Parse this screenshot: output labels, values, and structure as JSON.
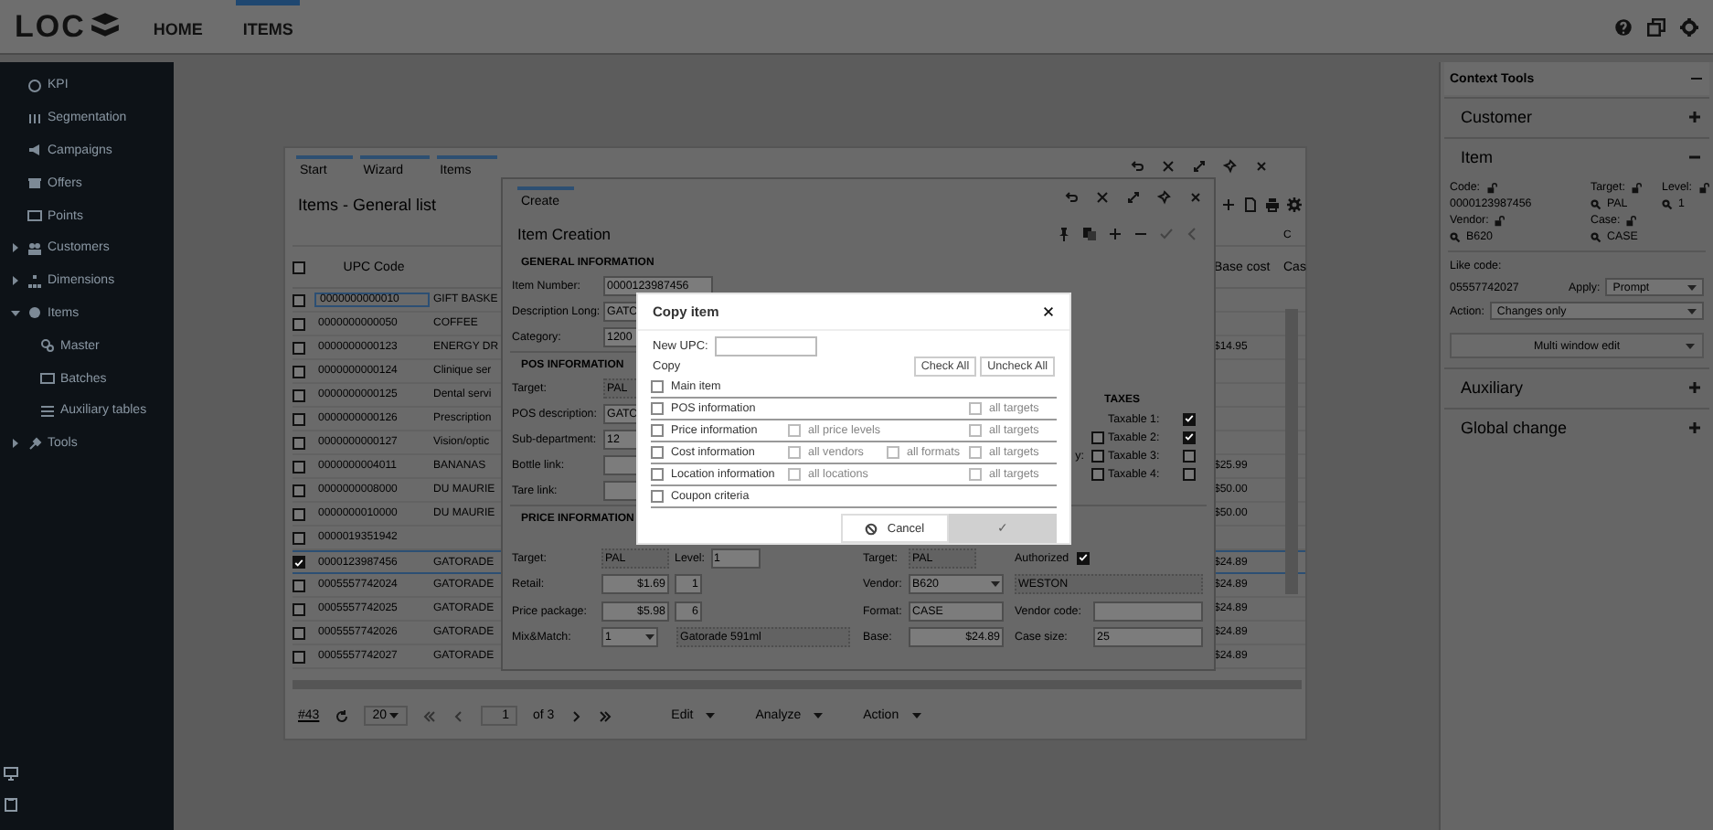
{
  "top_bar": {
    "logo": "LOC",
    "nav": [
      {
        "label": "HOME",
        "selected": false
      },
      {
        "label": "ITEMS",
        "selected": true
      }
    ]
  },
  "sidebar": {
    "items": [
      {
        "label": "KPI"
      },
      {
        "label": "Segmentation"
      },
      {
        "label": "Campaigns"
      },
      {
        "label": "Offers"
      },
      {
        "label": "Points"
      },
      {
        "label": "Customers",
        "expanded": false
      },
      {
        "label": "Dimensions",
        "expanded": false
      },
      {
        "label": "Items",
        "expanded": true,
        "children": [
          {
            "label": "Master"
          },
          {
            "label": "Batches"
          },
          {
            "label": "Auxiliary tables"
          }
        ]
      },
      {
        "label": "Tools",
        "expanded": false
      }
    ]
  },
  "list_window": {
    "breadcrumbs": [
      "Start",
      "Wizard",
      "Items"
    ],
    "title": "Items - General list",
    "group_header": "C",
    "select_all_checked": false,
    "columns": [
      "UPC Code",
      "Base cost",
      "Cas"
    ],
    "rows": [
      {
        "checked": false,
        "upc": "0000000000010",
        "description": "GIFT BASKE"
      },
      {
        "checked": false,
        "upc": "0000000000050",
        "description": "COFFEE"
      },
      {
        "checked": false,
        "upc": "0000000000123",
        "description": "ENERGY DR",
        "base_cost": "$14.95"
      },
      {
        "checked": false,
        "upc": "0000000000124",
        "description": "Clinique ser"
      },
      {
        "checked": false,
        "upc": "0000000000125",
        "description": "Dental servi"
      },
      {
        "checked": false,
        "upc": "0000000000126",
        "description": "Prescription"
      },
      {
        "checked": false,
        "upc": "0000000000127",
        "description": "Vision/optic"
      },
      {
        "checked": false,
        "upc": "0000000004011",
        "description": "BANANAS",
        "base_cost": "$25.99"
      },
      {
        "checked": false,
        "upc": "0000000008000",
        "description": "DU MAURIE",
        "base_cost": "$50.00"
      },
      {
        "checked": false,
        "upc": "0000000010000",
        "description": "DU MAURIE",
        "base_cost": "$50.00"
      },
      {
        "checked": false,
        "upc": "0000019351942"
      },
      {
        "checked": true,
        "upc": "0000123987456",
        "description": "GATORADE",
        "base_cost": "$24.89"
      },
      {
        "checked": false,
        "upc": "0005557742024",
        "description": "GATORADE",
        "base_cost": "$24.89"
      },
      {
        "checked": false,
        "upc": "0005557742025",
        "description": "GATORADE",
        "base_cost": "$24.89"
      },
      {
        "checked": false,
        "upc": "0005557742026",
        "description": "GATORADE",
        "base_cost": "$24.89"
      },
      {
        "checked": false,
        "upc": "0005557742027",
        "description": "GATORADE",
        "base_cost": "$24.89"
      }
    ],
    "footer": {
      "count": "#43",
      "page_size": "20",
      "page": "1",
      "page_total": "of 3",
      "menus": [
        "Edit",
        "Analyze",
        "Action"
      ]
    }
  },
  "creation_window": {
    "tab": "Create",
    "title": "Item Creation",
    "general": {
      "heading": "GENERAL INFORMATION",
      "fields": [
        {
          "label": "Item Number:",
          "value": "0000123987456",
          "disabled": false
        },
        {
          "label": "Description Long:",
          "value": "GATO",
          "disabled": false
        },
        {
          "label": "Category:",
          "value": "1200",
          "disabled": false
        }
      ]
    },
    "pos": {
      "heading": "POS INFORMATION",
      "fields": [
        {
          "label": "Target:",
          "value": "PAL",
          "disabled": true
        },
        {
          "label": "POS description:",
          "value": "GATO",
          "disabled": false
        },
        {
          "label": "Sub-department:",
          "value": "12",
          "disabled": false
        },
        {
          "label": "Bottle link:",
          "disabled": false
        },
        {
          "label": "Tare link:",
          "disabled": false
        }
      ]
    },
    "flags": [
      {
        "checked": false
      },
      {
        "label": "y:",
        "checked": false
      },
      {
        "checked": false
      }
    ],
    "taxes": {
      "heading": "TAXES",
      "items": [
        {
          "label": "Taxable 1:",
          "checked": true
        },
        {
          "label": "Taxable 2:",
          "checked": true
        },
        {
          "label": "Taxable 3:",
          "checked": false
        },
        {
          "label": "Taxable 4:",
          "checked": false
        }
      ]
    },
    "price": {
      "heading": "PRICE INFORMATION",
      "target": {
        "label": "Target:",
        "value": "PAL"
      },
      "level": {
        "label": "Level:",
        "value": "1"
      },
      "rows": [
        {
          "label": "Retail:",
          "amount": "$1.69",
          "quantity": "1"
        },
        {
          "label": "Price package:",
          "amount": "$5.98",
          "quantity": "6"
        }
      ],
      "mix_match": {
        "label": "Mix&Match:",
        "value": "1",
        "description": "Gatorade 591ml"
      }
    },
    "cost": {
      "target": {
        "label": "Target:",
        "value": "PAL"
      },
      "authorized": {
        "label": "Authorized",
        "checked": true
      },
      "vendor": {
        "label": "Vendor:",
        "value": "B620",
        "name": "WESTON"
      },
      "format": {
        "label": "Format:",
        "value": "CASE"
      },
      "vendor_code": {
        "label": "Vendor code:"
      },
      "base": {
        "label": "Base:",
        "value": "$24.89"
      },
      "case_size": {
        "label": "Case size:",
        "value": "25"
      }
    }
  },
  "copy_dialog": {
    "title": "Copy item",
    "new_upc_label": "New UPC:",
    "copy_label": "Copy",
    "check_all": "Check All",
    "uncheck_all": "Uncheck All",
    "options": [
      {
        "label": "Main item",
        "checked": false
      },
      {
        "label": "POS information",
        "checked": false,
        "scopes": [
          {
            "kind": "target",
            "label": "all targets",
            "checked": false,
            "disabled": true
          }
        ]
      },
      {
        "label": "Price information",
        "checked": false,
        "scopes": [
          {
            "kind": "primary",
            "label": "all price levels",
            "checked": false,
            "disabled": true
          },
          {
            "kind": "target",
            "label": "all targets",
            "checked": false,
            "disabled": true
          }
        ]
      },
      {
        "label": "Cost information",
        "checked": false,
        "scopes": [
          {
            "kind": "primary",
            "label": "all vendors",
            "checked": false,
            "disabled": true
          },
          {
            "kind": "format",
            "label": "all formats",
            "checked": false,
            "disabled": true
          },
          {
            "kind": "target",
            "label": "all targets",
            "checked": false,
            "disabled": true
          }
        ]
      },
      {
        "label": "Location information",
        "checked": false,
        "scopes": [
          {
            "kind": "primary",
            "label": "all locations",
            "checked": false,
            "disabled": true
          },
          {
            "kind": "target",
            "label": "all targets",
            "checked": false,
            "disabled": true
          }
        ]
      },
      {
        "label": "Coupon criteria",
        "checked": false
      }
    ],
    "cancel": "Cancel",
    "confirm": {
      "label": "✓",
      "disabled": true
    }
  },
  "context_tools": {
    "title": "Context Tools",
    "sections": [
      {
        "label": "Customer",
        "expanded": false
      },
      {
        "label": "Item",
        "expanded": true,
        "fields": {
          "code": {
            "label": "Code:",
            "value": "0000123987456"
          },
          "target": {
            "label": "Target:",
            "value": "PAL"
          },
          "level": {
            "label": "Level:",
            "value": "1"
          },
          "vendor": {
            "label": "Vendor:",
            "value": "B620"
          },
          "case": {
            "label": "Case:",
            "value": "CASE"
          },
          "like_code": {
            "label": "Like code:",
            "value": "05557742027"
          },
          "apply": {
            "label": "Apply:",
            "value": "Prompt"
          },
          "action": {
            "label": "Action:",
            "value": "Changes only"
          },
          "multi_edit": "Multi window edit"
        }
      },
      {
        "label": "Auxiliary",
        "expanded": false
      },
      {
        "label": "Global change",
        "expanded": false
      }
    ]
  }
}
